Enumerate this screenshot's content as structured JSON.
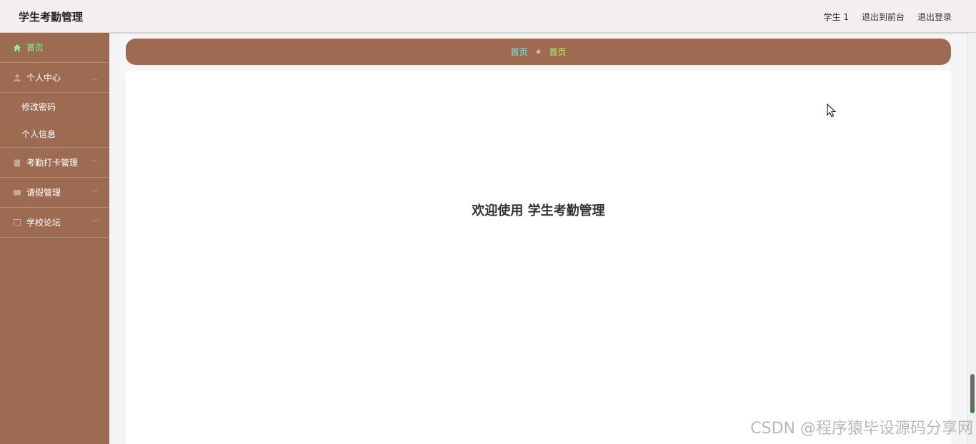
{
  "header": {
    "app_title": "学生考勤管理",
    "user": "学生 1",
    "back_to_front": "退出到前台",
    "logout": "退出登录"
  },
  "sidebar": {
    "home": "首页",
    "personal_center": "个人中心",
    "change_password": "修改密码",
    "personal_info": "个人信息",
    "attendance": "考勤打卡管理",
    "leave": "请假管理",
    "forum": "学校论坛"
  },
  "breadcrumb": {
    "item1": "首页",
    "separator": "★",
    "item2": "首页"
  },
  "main": {
    "welcome": "欢迎使用 学生考勤管理"
  },
  "watermark": "CSDN @程序猿毕设源码分享网",
  "colors": {
    "sidebar_bg": "#9c6b52",
    "active_menu": "#8ff28a",
    "header_bg": "#f4eeee"
  }
}
